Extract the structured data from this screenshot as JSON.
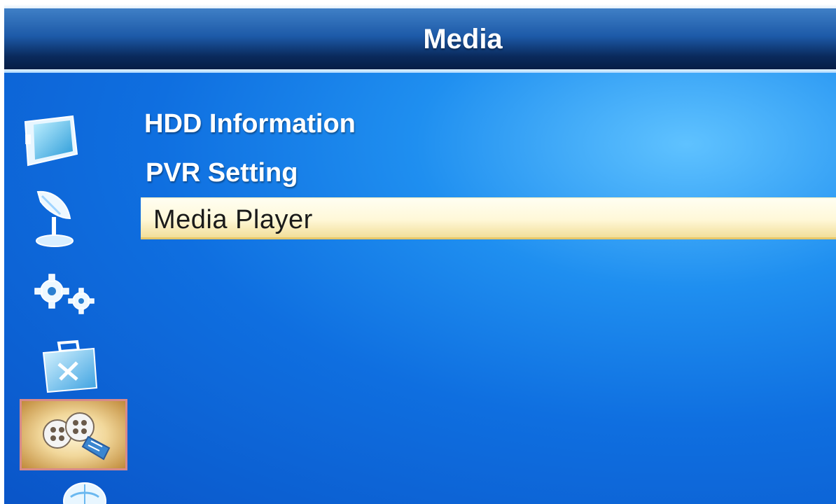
{
  "header": {
    "title": "Media"
  },
  "menu": {
    "items": [
      {
        "label": "HDD Information",
        "selected": false
      },
      {
        "label": "PVR Setting",
        "selected": false
      },
      {
        "label": "Media Player",
        "selected": true
      }
    ]
  },
  "sidebar": {
    "icons": [
      {
        "name": "tv-icon",
        "selected": false
      },
      {
        "name": "satellite-dish-icon",
        "selected": false
      },
      {
        "name": "gears-icon",
        "selected": false
      },
      {
        "name": "toolbox-icon",
        "selected": false
      },
      {
        "name": "film-reel-icon",
        "selected": true
      },
      {
        "name": "globe-icon",
        "selected": false
      }
    ]
  },
  "colors": {
    "background": "#0f6fe0",
    "title_bar": "#0a2a5c",
    "highlight": "#fff8d8",
    "highlight_border": "#e8c86a",
    "selected_icon_border": "#d88a8a"
  }
}
